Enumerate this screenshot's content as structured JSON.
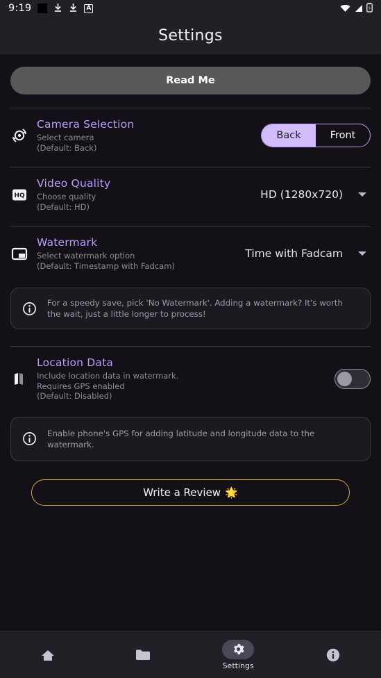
{
  "status_bar": {
    "time": "9:19",
    "left_icons": [
      "black-box-icon",
      "download-icon",
      "download-icon",
      "a-badge-icon"
    ],
    "right_icons": [
      "wifi-icon",
      "signal-icon",
      "battery-charging-icon"
    ]
  },
  "header": {
    "title": "Settings"
  },
  "readme": {
    "label": "Read Me"
  },
  "camera": {
    "icon": "flip-camera-icon",
    "title": "Camera Selection",
    "subtitle": "Select camera",
    "default_note": "(Default: Back)",
    "options": [
      "Back",
      "Front"
    ],
    "selected": "Back"
  },
  "video_quality": {
    "icon": "hq-badge-icon",
    "title": "Video Quality",
    "subtitle": "Choose quality",
    "default_note": "(Default: HD)",
    "value": "HD (1280x720)"
  },
  "watermark": {
    "icon": "branding-watermark-icon",
    "title": "Watermark",
    "subtitle": "Select watermark option",
    "default_note": "(Default: Timestamp with Fadcam)",
    "value": "Time with Fadcam"
  },
  "watermark_info": {
    "icon": "info-icon",
    "text": "For a speedy save, pick 'No Watermark'. Adding a watermark? It's worth the wait, just a little longer to process!"
  },
  "location": {
    "icon": "map-icon",
    "title": "Location Data",
    "subtitle_line1": "Include location data in watermark.",
    "subtitle_line2": "Requires GPS enabled",
    "default_note": "(Default: Disabled)",
    "enabled": false
  },
  "location_info": {
    "icon": "info-icon",
    "text": "Enable phone's GPS for adding latitude and longitude data to the watermark."
  },
  "review": {
    "label": "Write a Review",
    "emoji": "🌟"
  },
  "bottom_nav": {
    "items": [
      {
        "icon": "home-icon",
        "label": "",
        "active": false
      },
      {
        "icon": "folder-icon",
        "label": "",
        "active": false
      },
      {
        "icon": "gear-icon",
        "label": "Settings",
        "active": true
      },
      {
        "icon": "info-icon",
        "label": "",
        "active": false
      }
    ]
  },
  "colors": {
    "background": "#131117",
    "surface": "#212026",
    "accent_purple": "#b99dfb",
    "accent_purple_fill": "#d2bcfb",
    "accent_gold": "#d8a72b",
    "muted_text": "#8d8d96"
  }
}
